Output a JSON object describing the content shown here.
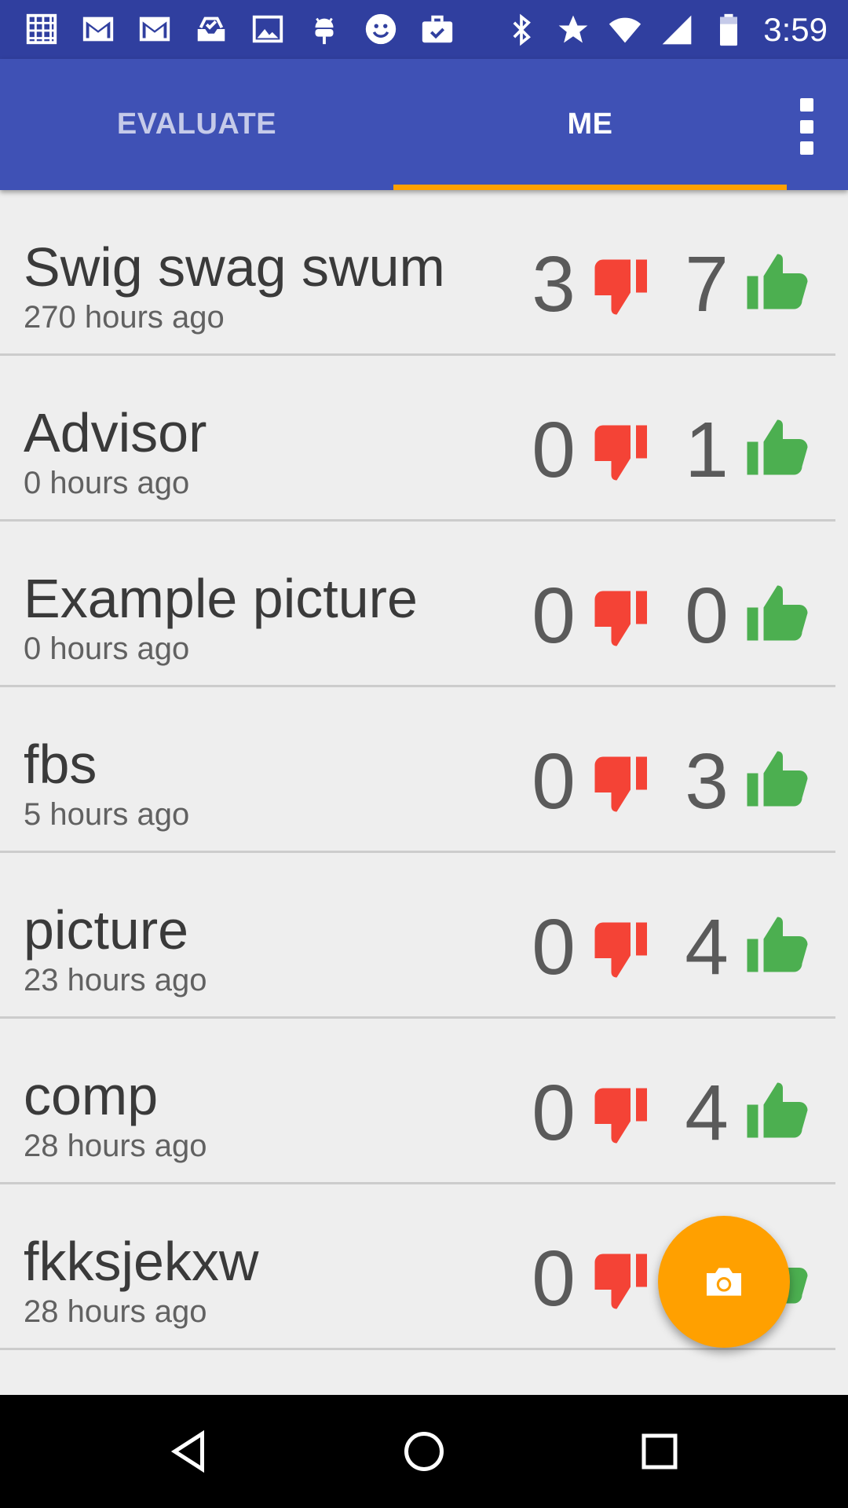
{
  "status_bar": {
    "time": "3:59",
    "left_icons": [
      "calendar-icon",
      "gmail-icon",
      "gmail-icon",
      "inbox-icon",
      "image-icon",
      "android-icon",
      "smiley-icon",
      "briefcase-icon"
    ],
    "right_icons": [
      "bluetooth-icon",
      "star-icon",
      "wifi-icon",
      "signal-icon",
      "battery-icon"
    ]
  },
  "tabs": [
    {
      "label": "EVALUATE",
      "selected": false
    },
    {
      "label": "ME",
      "selected": true
    }
  ],
  "colors": {
    "status_bar": "#303f9f",
    "app_bar": "#3f51b5",
    "accent": "#ffa000",
    "thumbs_down": "#f44336",
    "thumbs_up": "#4caf50"
  },
  "items": [
    {
      "title": "Swig swag swum",
      "time": "270 hours ago",
      "down": "3",
      "up": "7"
    },
    {
      "title": "Advisor",
      "time": "0 hours ago",
      "down": "0",
      "up": "1"
    },
    {
      "title": "Example picture",
      "time": "0 hours ago",
      "down": "0",
      "up": "0"
    },
    {
      "title": "fbs",
      "time": "5 hours ago",
      "down": "0",
      "up": "3"
    },
    {
      "title": "picture",
      "time": "23 hours ago",
      "down": "0",
      "up": "4"
    },
    {
      "title": "comp",
      "time": "28 hours ago",
      "down": "0",
      "up": "4"
    },
    {
      "title": "fkksjekxw",
      "time": "28 hours ago",
      "down": "0",
      "up": ""
    }
  ],
  "fab": {
    "icon": "camera-icon"
  },
  "nav": {
    "icons": [
      "back-icon",
      "home-icon",
      "recents-icon"
    ]
  }
}
